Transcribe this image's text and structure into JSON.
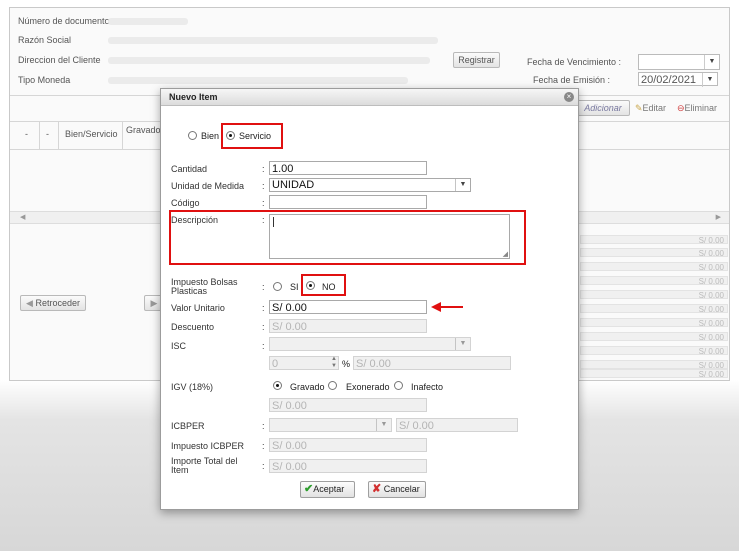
{
  "background_form": {
    "numero_documento_label": "Número de documento",
    "razon_social_label": "Razón Social",
    "direccion_label": "Direccion del Cliente",
    "tipo_moneda_label": "Tipo Moneda",
    "registrar_button": "Registrar",
    "fecha_vencimiento_label": "Fecha de Vencimiento  :",
    "fecha_emision_label": "Fecha de Emisión  :",
    "fecha_emision_value": "20/02/2021",
    "adicionar_button": "Adicionar",
    "editar_button": "Editar",
    "eliminar_button": "Eliminar",
    "table_headers": [
      "-",
      "-",
      "Bien/Servicio",
      "Gravado"
    ],
    "retroceder_button": "Retroceder",
    "money_cells": [
      "S/ 0.00",
      "S/ 0.00",
      "S/ 0.00",
      "S/ 0.00",
      "S/ 0.00",
      "S/ 0.00",
      "S/ 0.00",
      "S/ 0.00",
      "S/ 0.00",
      "S/ 0.00",
      "S/ 0.00"
    ]
  },
  "modal": {
    "title": "Nuevo Item",
    "type_options": {
      "bien": "Bien",
      "servicio": "Servicio",
      "selected": "Servicio"
    },
    "cantidad": {
      "label": "Cantidad",
      "value": "1.00"
    },
    "unidad_medida": {
      "label": "Unidad de Medida",
      "value": "UNIDAD"
    },
    "codigo": {
      "label": "Código",
      "value": ""
    },
    "descripcion": {
      "label": "Descripción",
      "value": ""
    },
    "impuesto_bolsas": {
      "label": "Impuesto Bolsas Plasticas",
      "si": "SI",
      "no": "NO",
      "selected": "NO"
    },
    "valor_unitario": {
      "label": "Valor Unitario",
      "value": "S/ 0.00"
    },
    "descuento": {
      "label": "Descuento",
      "value": "S/ 0.00"
    },
    "isc": {
      "label": "ISC",
      "select_value": "",
      "percent_value": "0",
      "percent_sign": "%",
      "amount": "S/ 0.00"
    },
    "igv": {
      "label": "IGV (18%)",
      "gravado": "Gravado",
      "exonerado": "Exonerado",
      "inafecto": "Inafecto",
      "selected": "Gravado",
      "amount": "S/ 0.00"
    },
    "icbper": {
      "label": "ICBPER",
      "select_value": "",
      "amount": "S/ 0.00"
    },
    "impuesto_icbper": {
      "label": "Impuesto ICBPER",
      "value": "S/ 0.00"
    },
    "importe_total": {
      "label": "Importe Total del Item",
      "value": "S/ 0.00"
    },
    "aceptar_button": "Aceptar",
    "cancelar_button": "Cancelar"
  },
  "colors": {
    "annotation_red": "#e01010",
    "accept_green": "#2e9e2e",
    "cancel_red": "#d23030"
  }
}
